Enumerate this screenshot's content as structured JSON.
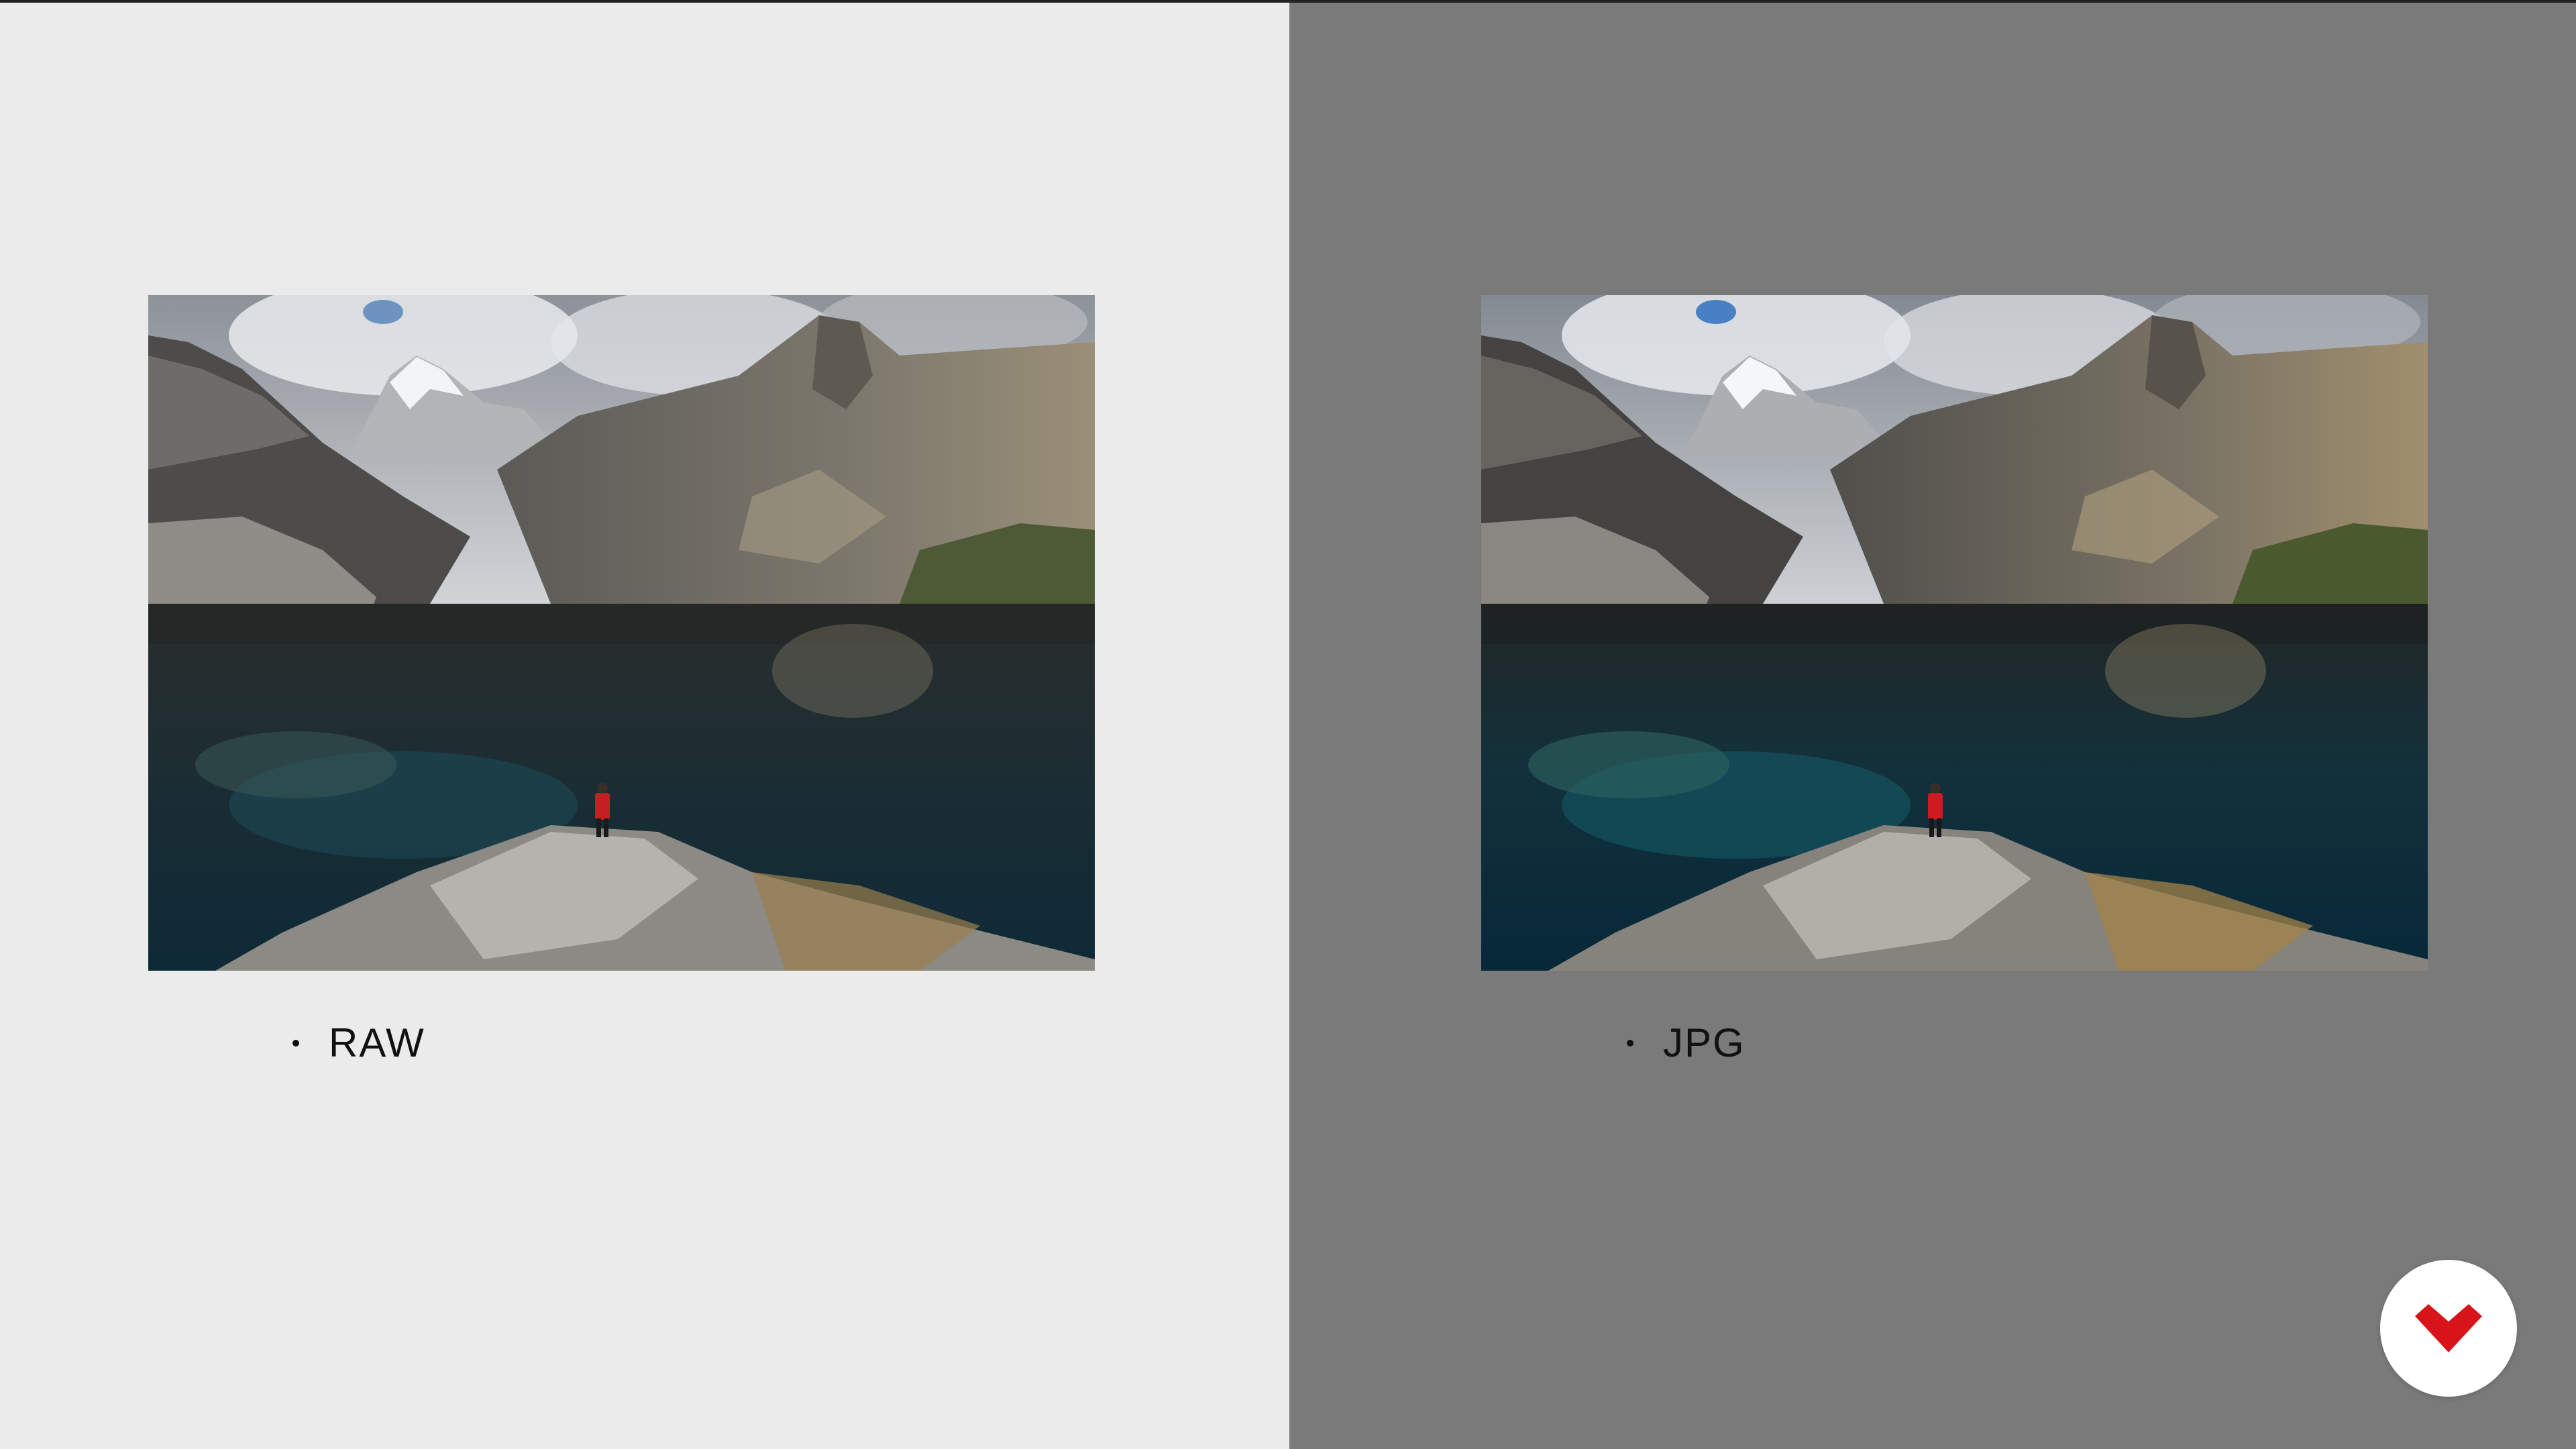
{
  "slide": {
    "left_panel": {
      "background": "#EBEBEB",
      "caption": "RAW",
      "photo_icon": "landscape-photo"
    },
    "right_panel": {
      "background": "#7A7A7A",
      "caption": "JPG",
      "photo_icon": "landscape-photo"
    },
    "logo": {
      "icon": "brand-logo-icon",
      "color": "#D7141A"
    }
  }
}
